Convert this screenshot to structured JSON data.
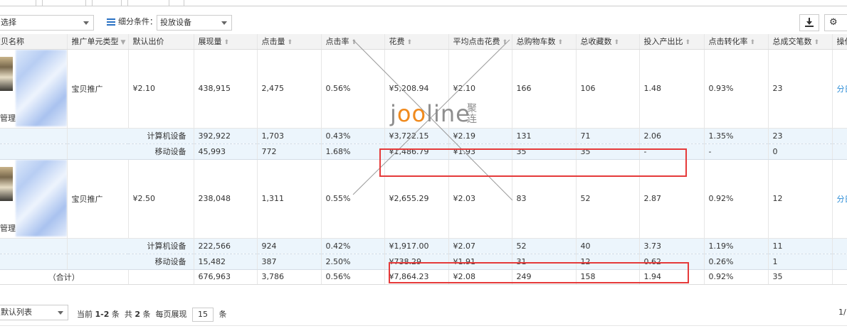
{
  "filters": {
    "select_1": "选择",
    "segment_label": "细分条件：",
    "segment_value": "投放设备"
  },
  "columns": [
    "推广单元类型",
    "默认出价",
    "展现量",
    "点击量",
    "点击率",
    "花费",
    "平均点击花费",
    "总购物车数",
    "总收藏数",
    "投入产出比",
    "点击转化率",
    "总成交笔数",
    "操作"
  ],
  "col_name_header": "宝贝名称",
  "rows": [
    {
      "thumb_label": "管理",
      "type": "宝贝推广",
      "bid": "¥2.10",
      "impressions": "438,915",
      "clicks": "2,475",
      "ctr": "0.56%",
      "cost": "¥5,208.94",
      "cpc": "¥2.10",
      "cart": "166",
      "fav": "106",
      "roi": "1.48",
      "cvr": "0.93%",
      "orders": "23",
      "action": "分日",
      "subs": [
        {
          "device": "计算机设备",
          "impressions": "392,922",
          "clicks": "1,703",
          "ctr": "0.43%",
          "cost": "¥3,722.15",
          "cpc": "¥2.19",
          "cart": "131",
          "fav": "71",
          "roi": "2.06",
          "cvr": "1.35%",
          "orders": "23"
        },
        {
          "device": "移动设备",
          "impressions": "45,993",
          "clicks": "772",
          "ctr": "1.68%",
          "cost": "¥1,486.79",
          "cpc": "¥1.93",
          "cart": "35",
          "fav": "35",
          "roi": "-",
          "cvr": "-",
          "orders": "0"
        }
      ]
    },
    {
      "thumb_label": "管理",
      "type": "宝贝推广",
      "bid": "¥2.50",
      "impressions": "238,048",
      "clicks": "1,311",
      "ctr": "0.55%",
      "cost": "¥2,655.29",
      "cpc": "¥2.03",
      "cart": "83",
      "fav": "52",
      "roi": "2.87",
      "cvr": "0.92%",
      "orders": "12",
      "action": "分日",
      "subs": [
        {
          "device": "计算机设备",
          "impressions": "222,566",
          "clicks": "924",
          "ctr": "0.42%",
          "cost": "¥1,917.00",
          "cpc": "¥2.07",
          "cart": "52",
          "fav": "40",
          "roi": "3.73",
          "cvr": "1.19%",
          "orders": "11"
        },
        {
          "device": "移动设备",
          "impressions": "15,482",
          "clicks": "387",
          "ctr": "2.50%",
          "cost": "¥738.29",
          "cpc": "¥1.91",
          "cart": "31",
          "fav": "12",
          "roi": "0.62",
          "cvr": "0.26%",
          "orders": "1"
        }
      ]
    }
  ],
  "total": {
    "label": "（合计）",
    "impressions": "676,963",
    "clicks": "3,786",
    "ctr": "0.56%",
    "cost": "¥7,864.23",
    "cpc": "¥2.08",
    "cart": "249",
    "fav": "158",
    "roi": "1.94",
    "cvr": "0.92%",
    "orders": "35"
  },
  "pager": {
    "view_select": "默认列表",
    "current_prefix": "当前",
    "current_range": "1-2",
    "current_unit": "条",
    "total_prefix": "共",
    "total_count": "2",
    "total_unit": "条",
    "per_page_label": "每页展现",
    "per_page": "15",
    "per_page_unit": "条",
    "page_indicator": "1/"
  },
  "watermark": {
    "brand_pre": "j",
    "brand_oo": "oo",
    "brand_post": "line",
    "brand_cn": "聚连"
  },
  "colors": {
    "highlight_box": "#e53a3a",
    "link": "#2a8cd6",
    "sub_row_bg": "#ecf5fc",
    "watermark_accent": "#f08a1d"
  }
}
